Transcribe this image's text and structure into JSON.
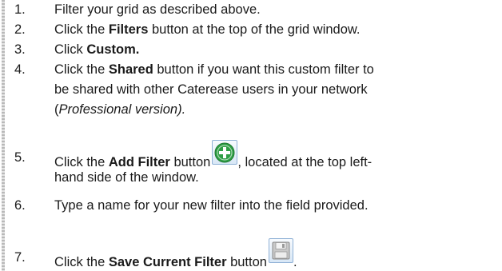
{
  "steps": [
    {
      "num": "1.",
      "pre": "Filter your grid as described above."
    },
    {
      "num": "2.",
      "pre": "Click the ",
      "bold": "Filters",
      "post": " button at the top of the grid window."
    },
    {
      "num": "3.",
      "pre": "Click ",
      "bold": "Custom."
    },
    {
      "num": "4.",
      "pre": "Click the ",
      "bold": "Shared",
      "post": " button if you want this custom filter to",
      "line2": "be shared with other Caterease users in your network",
      "line3_pre": "(",
      "line3_italic": "Professional version).",
      "line3_post": ""
    },
    {
      "num": "5.",
      "pre": "Click the ",
      "bold": "Add Filter",
      "post": " button",
      "post2": ", located at the top left-",
      "line2": "hand side of the window."
    },
    {
      "num": "6.",
      "pre": "Type a name for your new filter into the field provided."
    },
    {
      "num": "7.",
      "pre": "Click the ",
      "bold": "Save Current Filter",
      "post": " button",
      "post2": "."
    }
  ],
  "icons": {
    "add": "add-plus-icon",
    "save": "save-floppy-icon",
    "accent": "#2e9e45"
  }
}
